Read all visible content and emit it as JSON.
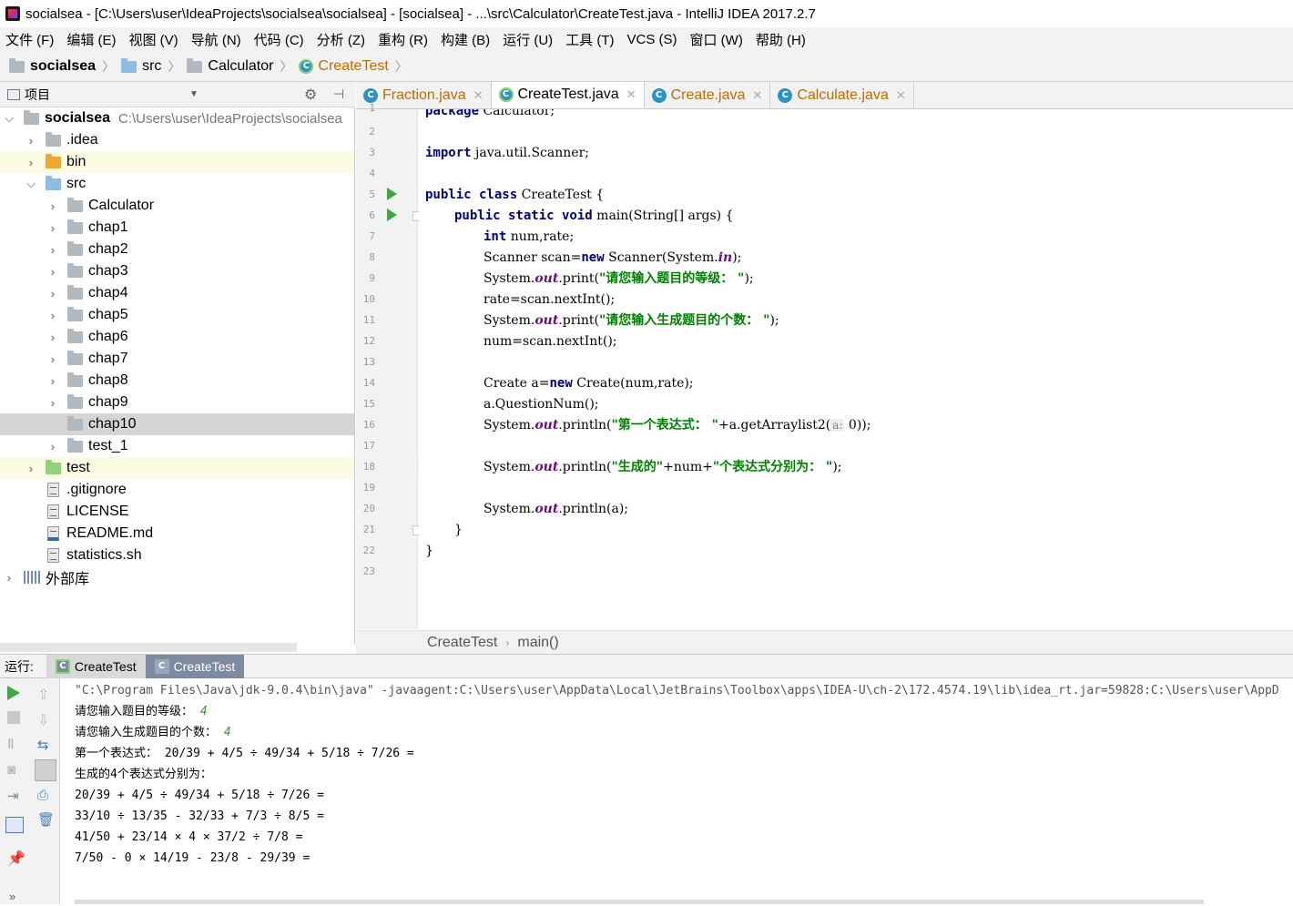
{
  "window": {
    "title": "socialsea - [C:\\Users\\user\\IdeaProjects\\socialsea\\socialsea] - [socialsea] - ...\\src\\Calculator\\CreateTest.java - IntelliJ IDEA 2017.2.7"
  },
  "menu": [
    "文件 (F)",
    "编辑 (E)",
    "视图 (V)",
    "导航 (N)",
    "代码 (C)",
    "分析 (Z)",
    "重构 (R)",
    "构建 (B)",
    "运行 (U)",
    "工具 (T)",
    "VCS (S)",
    "窗口 (W)",
    "帮助 (H)"
  ],
  "breadcrumb": [
    "socialsea",
    "src",
    "Calculator",
    "CreateTest"
  ],
  "project_panel": {
    "title": "项目",
    "tree": [
      {
        "label": "socialsea",
        "path": "C:\\Users\\user\\IdeaProjects\\socialsea",
        "icon": "module-folder-icon"
      },
      {
        "label": ".idea",
        "icon": "folder-icon"
      },
      {
        "label": "bin",
        "icon": "excluded-folder-icon"
      },
      {
        "label": "src",
        "icon": "source-folder-icon"
      },
      {
        "label": "Calculator",
        "icon": "package-icon"
      },
      {
        "label": "chap1",
        "icon": "package-icon"
      },
      {
        "label": "chap2",
        "icon": "package-icon"
      },
      {
        "label": "chap3",
        "icon": "package-icon"
      },
      {
        "label": "chap4",
        "icon": "package-icon"
      },
      {
        "label": "chap5",
        "icon": "package-icon"
      },
      {
        "label": "chap6",
        "icon": "package-icon"
      },
      {
        "label": "chap7",
        "icon": "package-icon"
      },
      {
        "label": "chap8",
        "icon": "package-icon"
      },
      {
        "label": "chap9",
        "icon": "package-icon"
      },
      {
        "label": "chap10",
        "icon": "package-icon"
      },
      {
        "label": "test_1",
        "icon": "package-icon"
      },
      {
        "label": "test",
        "icon": "test-folder-icon"
      },
      {
        "label": ".gitignore",
        "icon": "file-icon"
      },
      {
        "label": "LICENSE",
        "icon": "file-icon"
      },
      {
        "label": "README.md",
        "icon": "markdown-file-icon"
      },
      {
        "label": "statistics.sh",
        "icon": "file-icon"
      },
      {
        "label": "外部库",
        "icon": "library-icon"
      }
    ]
  },
  "editor": {
    "tabs": [
      "Fraction.java",
      "CreateTest.java",
      "Create.java",
      "Calculate.java"
    ],
    "active_tab": "CreateTest.java",
    "line_numbers": [
      "1",
      "2",
      "3",
      "4",
      "5",
      "6",
      "7",
      "8",
      "9",
      "10",
      "11",
      "12",
      "13",
      "14",
      "15",
      "16",
      "17",
      "18",
      "19",
      "20",
      "21",
      "22",
      "23"
    ],
    "code": {
      "l1_kw": "package",
      "l1_rest": " Calculator;",
      "l3_kw": "import",
      "l3_rest": " java.util.Scanner;",
      "l5_kw": "public class",
      "l5_rest": " CreateTest {",
      "l6_kw": "public static void",
      "l6_rest": " main(String[] args) {",
      "l7_kw": "int",
      "l7_rest": " num,rate;",
      "l8_a": "Scanner scan=",
      "l8_kw": "new",
      "l8_b": " Scanner(System.",
      "l8_fi": "in",
      "l8_c": ");",
      "l9_a": "System.",
      "l9_fi": "out",
      "l9_b": ".print(",
      "l9_st": "\"请您输入题目的等级： \"",
      "l9_c": ");",
      "l10": "rate=scan.nextInt();",
      "l11_a": "System.",
      "l11_fi": "out",
      "l11_b": ".print(",
      "l11_st": "\"请您输入生成题目的个数： \"",
      "l11_c": ");",
      "l12": "num=scan.nextInt();",
      "l14_a": "Create a=",
      "l14_kw": "new",
      "l14_b": " Create(num,rate);",
      "l15": "a.QuestionNum();",
      "l16_a": "System.",
      "l16_fi": "out",
      "l16_b": ".println(",
      "l16_st": "\"第一个表达式： \"",
      "l16_c": "+a.getArraylist2(",
      "l16_hint": "a:",
      "l16_d": " 0));",
      "l18_a": "System.",
      "l18_fi": "out",
      "l18_b": ".println(",
      "l18_st1": "\"生成的\"",
      "l18_c": "+num+",
      "l18_st2": "\"个表达式分别为： \"",
      "l18_d": ");",
      "l20_a": "System.",
      "l20_fi": "out",
      "l20_b": ".println(a);",
      "l21": "}",
      "l22": "}"
    },
    "bottom_breadcrumb": [
      "CreateTest",
      "main()"
    ]
  },
  "run_panel": {
    "label": "运行:",
    "tabs": [
      "CreateTest",
      "CreateTest"
    ],
    "console": {
      "cmd": "\"C:\\Program Files\\Java\\jdk-9.0.4\\bin\\java\" -javaagent:C:\\Users\\user\\AppData\\Local\\JetBrains\\Toolbox\\apps\\IDEA-U\\ch-2\\172.4574.19\\lib\\idea_rt.jar=59828:C:\\Users\\user\\AppD",
      "prompt1": "请您输入题目的等级： ",
      "input1": "4",
      "prompt2": "请您输入生成题目的个数： ",
      "input2": "4",
      "line3": "第一个表达式： 20/39 + 4/5 ÷ 49/34 + 5/18 ÷ 7/26 =",
      "line4": "生成的4个表达式分别为：",
      "line5": "20/39 + 4/5 ÷ 49/34 + 5/18 ÷ 7/26 =",
      "line6": "33/10 ÷ 13/35 - 32/33 + 7/3 ÷ 8/5 =",
      "line7": "41/50 + 23/14 × 4 × 37/2 ÷ 7/8 =",
      "line8": "7/50 - 0 × 14/19 - 23/8 - 29/39 ="
    }
  },
  "colors": {
    "keyword": "#000080",
    "string": "#008000",
    "field": "#660e7a",
    "caret_row": "#fcfbe3",
    "run_green": "#3fa93f"
  }
}
